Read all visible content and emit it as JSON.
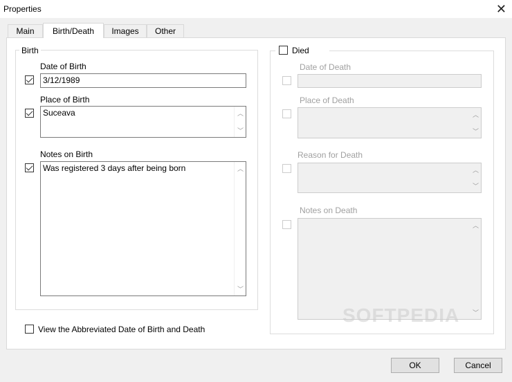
{
  "window": {
    "title": "Properties",
    "close_icon": "close-icon"
  },
  "tabs": [
    {
      "label": "Main"
    },
    {
      "label": "Birth/Death",
      "selected": true
    },
    {
      "label": "Images"
    },
    {
      "label": "Other"
    }
  ],
  "birth": {
    "group_label": "Birth",
    "date": {
      "label": "Date of Birth",
      "checked": true,
      "value": "3/12/1989"
    },
    "place": {
      "label": "Place of Birth",
      "checked": true,
      "value": "Suceava"
    },
    "notes": {
      "label": "Notes on Birth",
      "checked": true,
      "value": "Was registered 3 days after being born"
    }
  },
  "death": {
    "died_label": "Died",
    "died_checked": false,
    "date": {
      "label": "Date of Death",
      "value": ""
    },
    "place": {
      "label": "Place of Death",
      "value": ""
    },
    "reason": {
      "label": "Reason for Death",
      "value": ""
    },
    "notes": {
      "label": "Notes on Death",
      "value": ""
    }
  },
  "abbrev": {
    "label": "View the Abbreviated Date of Birth and Death",
    "checked": false
  },
  "buttons": {
    "ok": "OK",
    "cancel": "Cancel"
  },
  "watermark": "SOFTPEDIA"
}
